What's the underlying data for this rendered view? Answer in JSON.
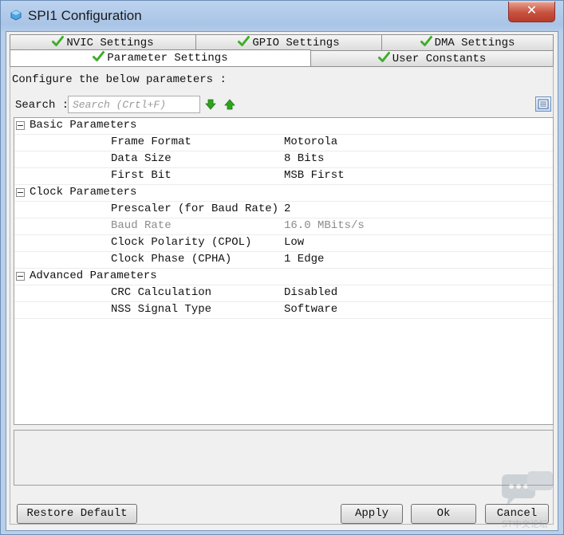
{
  "window": {
    "title": "SPI1 Configuration",
    "close_glyph": "✕"
  },
  "tabs": [
    {
      "label": "NVIC Settings",
      "checked": true
    },
    {
      "label": "GPIO Settings",
      "checked": true
    },
    {
      "label": "DMA Settings",
      "checked": true
    },
    {
      "label": "Parameter Settings",
      "checked": true,
      "active": true
    },
    {
      "label": "User Constants",
      "checked": true
    }
  ],
  "panel": {
    "configure_text": "Configure the below parameters :",
    "search_label": "Search :",
    "search_placeholder": "Search (Crtl+F)",
    "search_value": ""
  },
  "groups": [
    {
      "name": "Basic Parameters",
      "params": [
        {
          "name": "Frame Format",
          "value": "Motorola"
        },
        {
          "name": "Data Size",
          "value": "8 Bits"
        },
        {
          "name": "First Bit",
          "value": "MSB First"
        }
      ]
    },
    {
      "name": "Clock Parameters",
      "params": [
        {
          "name": "Prescaler (for Baud Rate)",
          "value": "2"
        },
        {
          "name": "Baud Rate",
          "value": "16.0 MBits/s",
          "disabled": true
        },
        {
          "name": "Clock Polarity (CPOL)",
          "value": "Low"
        },
        {
          "name": "Clock Phase (CPHA)",
          "value": "1 Edge"
        }
      ]
    },
    {
      "name": "Advanced Parameters",
      "params": [
        {
          "name": "CRC Calculation",
          "value": "Disabled"
        },
        {
          "name": "NSS Signal Type",
          "value": "Software"
        }
      ]
    }
  ],
  "buttons": {
    "restore_default": "Restore Default",
    "apply": "Apply",
    "ok": "Ok",
    "cancel": "Cancel"
  },
  "watermark": {
    "text": "ST中文论坛"
  },
  "colors": {
    "check_green": "#3fae29",
    "arrow_green": "#2fa31d",
    "title_bar": "#a9c4e6",
    "close_red": "#c7523f"
  }
}
